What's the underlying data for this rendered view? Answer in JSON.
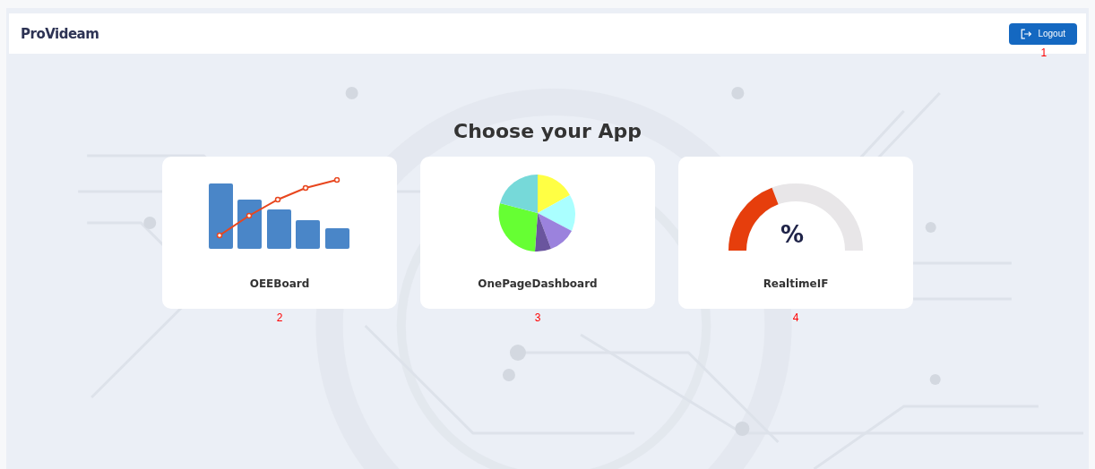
{
  "header": {
    "logo": "ProVideam",
    "logout_button": {
      "label": "Logout",
      "marker": "1"
    }
  },
  "title": "Choose your App",
  "apps": [
    {
      "kind": "bars",
      "name": "OEEBoard",
      "marker": "2"
    },
    {
      "kind": "pie",
      "name": "OnePageDashboard",
      "marker": "3"
    },
    {
      "kind": "gauge",
      "name": "RealtimeIF",
      "marker": "4",
      "symbol": "%"
    }
  ]
}
